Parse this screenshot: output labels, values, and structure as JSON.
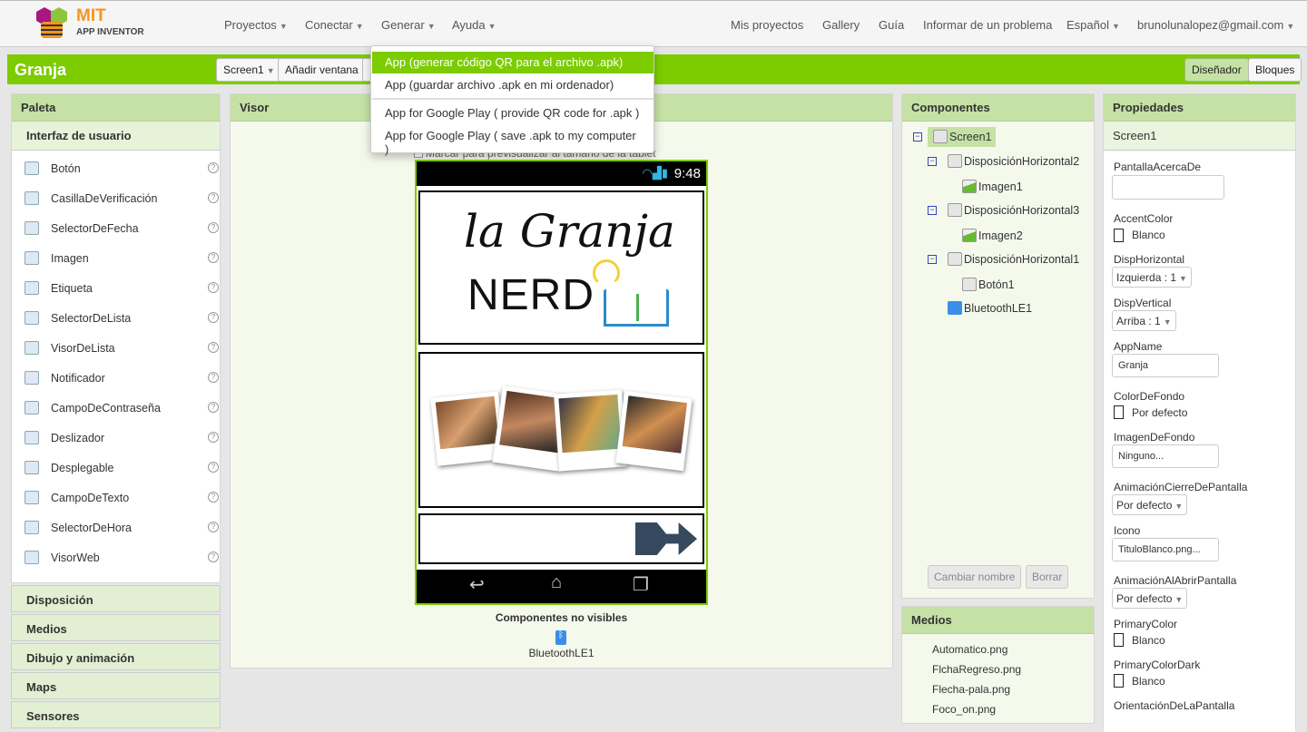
{
  "header": {
    "logo_top": "MIT",
    "logo_bottom": "APP INVENTOR",
    "menus": [
      "Proyectos",
      "Conectar",
      "Generar",
      "Ayuda"
    ],
    "right_links": [
      "Mis proyectos",
      "Gallery",
      "Guía",
      "Informar de un problema"
    ],
    "language": "Español",
    "user": "brunolunalopez@gmail.com"
  },
  "toolbar": {
    "project": "Granja",
    "screen": "Screen1",
    "add_screen": "Añadir ventana",
    "designer": "Diseñador",
    "blocks": "Bloques"
  },
  "dropdown": {
    "items": [
      "App (generar código QR para el archivo .apk)",
      "App (guardar archivo .apk en mi ordenador)",
      "App for Google Play ( provide QR code for .apk )",
      "App for Google Play ( save .apk to my computer )"
    ]
  },
  "palette": {
    "title": "Paleta",
    "section": "Interfaz de usuario",
    "items": [
      "Botón",
      "CasillaDeVerificación",
      "SelectorDeFecha",
      "Imagen",
      "Etiqueta",
      "SelectorDeLista",
      "VisorDeLista",
      "Notificador",
      "CampoDeContraseña",
      "Deslizador",
      "Desplegable",
      "CampoDeTexto",
      "SelectorDeHora",
      "VisorWeb"
    ],
    "help": "?",
    "categories": [
      "Disposición",
      "Medios",
      "Dibujo y animación",
      "Maps",
      "Sensores"
    ]
  },
  "viewer": {
    "title": "Visor",
    "tablet_preview": "Marcar para previsualizar al tamaño de la tablet",
    "time": "9:48",
    "logo_line1": "la Granja",
    "logo_line2": "NERD",
    "nonvisible_title": "Componentes no visibles",
    "nonvisible_item": "BluetoothLE1"
  },
  "components": {
    "title": "Componentes",
    "tree": [
      "Screen1",
      "DisposiciónHorizontal2",
      "Imagen1",
      "DisposiciónHorizontal3",
      "Imagen2",
      "DisposiciónHorizontal1",
      "Botón1",
      "BluetoothLE1"
    ],
    "rename": "Cambiar nombre",
    "delete": "Borrar"
  },
  "media": {
    "title": "Medios",
    "files": [
      "Automatico.png",
      "FlchaRegreso.png",
      "Flecha-pala.png",
      "Foco_on.png"
    ]
  },
  "properties": {
    "title": "Propiedades",
    "component": "Screen1",
    "about_label": "PantallaAcercaDe",
    "about_value": "",
    "accent_label": "AccentColor",
    "accent_value": "Blanco",
    "halign_label": "DispHorizontal",
    "halign_value": "Izquierda : 1",
    "valign_label": "DispVertical",
    "valign_value": "Arriba : 1",
    "appname_label": "AppName",
    "appname_value": "Granja",
    "bg_label": "ColorDeFondo",
    "bg_value": "Por defecto",
    "bgimg_label": "ImagenDeFondo",
    "bgimg_value": "Ninguno...",
    "close_anim_label": "AnimaciónCierreDePantalla",
    "close_anim_value": "Por defecto",
    "icon_label": "Icono",
    "icon_value": "TituloBlanco.png...",
    "open_anim_label": "AnimaciónAlAbrirPantalla",
    "open_anim_value": "Por defecto",
    "primary_label": "PrimaryColor",
    "primary_value": "Blanco",
    "primary_dark_label": "PrimaryColorDark",
    "primary_dark_value": "Blanco",
    "orientation_label": "OrientaciónDeLaPantalla"
  },
  "colors": {
    "accent_green": "#7ccc00",
    "panel_header": "#c5e1a5",
    "logo_orange": "#f7941d"
  }
}
